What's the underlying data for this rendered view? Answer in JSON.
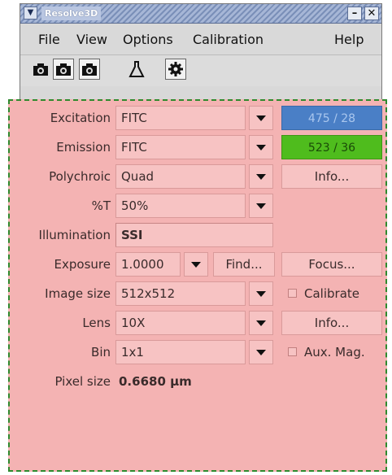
{
  "window": {
    "title": "Resolve3D"
  },
  "menu": {
    "file": "File",
    "view": "View",
    "options": "Options",
    "calibration": "Calibration",
    "help": "Help"
  },
  "panel": {
    "excitation": {
      "label": "Excitation",
      "value": "FITC",
      "readout": "475 / 28",
      "color": "#4a7fc6"
    },
    "emission": {
      "label": "Emission",
      "value": "FITC",
      "readout": "523 / 36",
      "color": "#4fbc1d"
    },
    "polychroic": {
      "label": "Polychroic",
      "value": "Quad",
      "info": "Info..."
    },
    "transmission": {
      "label": "%T",
      "value": "50%"
    },
    "illumination": {
      "label": "Illumination",
      "value": "SSI"
    },
    "exposure": {
      "label": "Exposure",
      "value": "1.0000",
      "find": "Find...",
      "focus": "Focus..."
    },
    "image_size": {
      "label": "Image size",
      "value": "512x512",
      "calibrate": "Calibrate"
    },
    "lens": {
      "label": "Lens",
      "value": "10X",
      "info": "Info..."
    },
    "bin": {
      "label": "Bin",
      "value": "1x1",
      "aux": "Aux. Mag."
    },
    "pixel_size": {
      "label": "Pixel size",
      "value": "0.6680 µm"
    }
  }
}
